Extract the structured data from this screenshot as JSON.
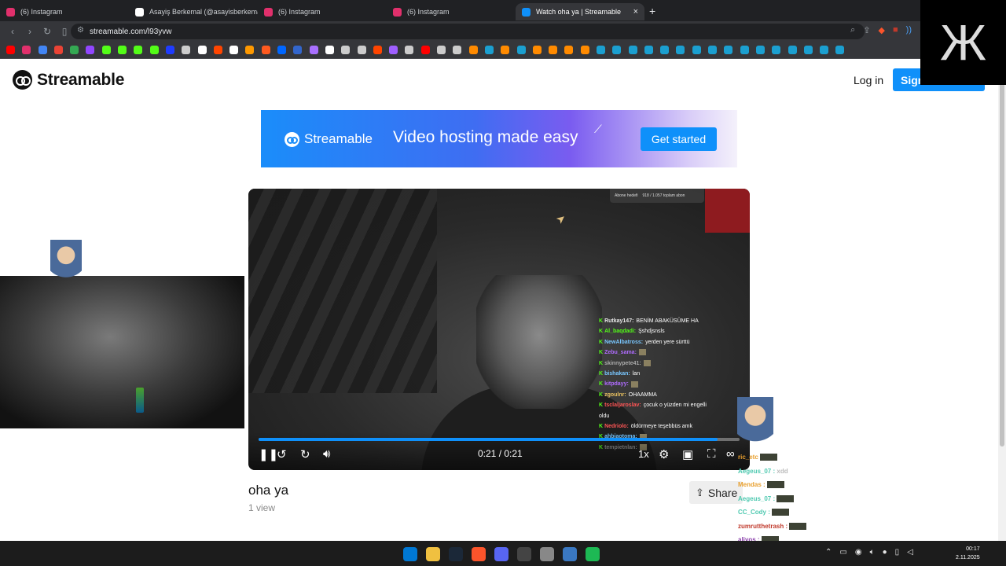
{
  "browser": {
    "tabs": [
      {
        "title": "(6) Instagram",
        "icon": "instagram-icon",
        "color": "#e1306c"
      },
      {
        "title": "Asayiş Berkemal (@asayisberkemal0)",
        "icon": "x-icon",
        "color": "#ffffff"
      },
      {
        "title": "(6) Instagram",
        "icon": "instagram-icon",
        "color": "#e1306c"
      },
      {
        "title": "(6) Instagram",
        "icon": "instagram-icon",
        "color": "#e1306c"
      },
      {
        "title": "Watch oha ya | Streamable",
        "icon": "streamable-icon",
        "color": "#0f90fa",
        "active": true
      }
    ],
    "url": "streamable.com/l93yvw"
  },
  "bookmark_colors": [
    "#ff0000",
    "#e1306c",
    "#4285f4",
    "#ea4335",
    "#34a853",
    "#9146ff",
    "#53fc18",
    "#53fc18",
    "#53fc18",
    "#53fc18",
    "#1f3cff",
    "#cccccc",
    "#ffffff",
    "#ff4500",
    "#ffffff",
    "#ff9900",
    "#ff5a1f",
    "#0066ff",
    "#3366cc",
    "#a970ff",
    "#ffffff",
    "#cccccc",
    "#cccccc",
    "#ff4500",
    "#9f5fff",
    "#cccccc",
    "#ff0000",
    "#cccccc",
    "#cccccc",
    "#ff8a00",
    "#1b9fd0",
    "#ff8a00",
    "#1b9fd0",
    "#ff8a00",
    "#ff8a00",
    "#ff8a00",
    "#ff8a00",
    "#1b9fd0",
    "#1b9fd0",
    "#1b9fd0",
    "#1b9fd0",
    "#1b9fd0",
    "#1b9fd0",
    "#1b9fd0",
    "#1b9fd0",
    "#1b9fd0",
    "#1b9fd0",
    "#1b9fd0",
    "#1b9fd0",
    "#1b9fd0",
    "#1b9fd0",
    "#1b9fd0",
    "#1b9fd0"
  ],
  "site": {
    "brand": "Streamable",
    "login": "Log in",
    "signup": "Sign",
    "accent": "#0f90fa"
  },
  "banner": {
    "brand": "Streamable",
    "tagline": "Video hosting made easy",
    "cta": "Get started"
  },
  "video": {
    "time": "0:21 / 0:21",
    "progress": 0.955,
    "speed": "1x",
    "hud_left": "Abone hedefi",
    "hud_right": "918 / 1.057 toplam abon",
    "chat": [
      {
        "user": "Rutkay147:",
        "msg": "BENİM ABAKÜSÜME HA",
        "color": "#e8e8e8"
      },
      {
        "user": "Al_baqdadi:",
        "msg": "Şshdjsnsls",
        "color": "#53fc18"
      },
      {
        "user": "NewAlbatross:",
        "msg": "yerden yere sürttü",
        "color": "#79c7ff"
      },
      {
        "user": "Zebu_sama:",
        "msg": "",
        "color": "#b06cff",
        "pic": true
      },
      {
        "user": "skinnypete41:",
        "msg": "",
        "color": "#aaaaaa",
        "pic": true
      },
      {
        "user": "bishakan:",
        "msg": "lan",
        "color": "#79c7ff"
      },
      {
        "user": "kitpdayy:",
        "msg": "",
        "color": "#b06cff",
        "pic": true
      },
      {
        "user": "zgoulnr:",
        "msg": "OHAAMMA",
        "color": "#e8c060"
      },
      {
        "user": "tsclaljaroslav:",
        "msg": "çocuk o yüzden mi engelli",
        "color": "#ff5555"
      },
      {
        "user": "",
        "msg": "oldu",
        "color": "#ffffff"
      },
      {
        "user": "Nedriolo:",
        "msg": "öldürmeye teşebbüs amk",
        "color": "#ff5555"
      },
      {
        "user": "ahbiaotoma:",
        "msg": "",
        "color": "#79c7ff",
        "pic": true
      },
      {
        "user": "tempietnlan:",
        "msg": "",
        "color": "#888888",
        "pic": true
      }
    ]
  },
  "meta": {
    "title": "oha ya",
    "views": "1 view",
    "share": "Share"
  },
  "overlay_chat": [
    {
      "user": "ric_etc",
      "color": "#e8a030"
    },
    {
      "user": "Aegeus_07 :",
      "text": "xdd",
      "color": "#4ec9b0"
    },
    {
      "user": "Mendas :",
      "color": "#e8a030"
    },
    {
      "user": "Aegeus_07 :",
      "color": "#4ec9b0"
    },
    {
      "user": "CC_Cody :",
      "color": "#4ec9b0"
    },
    {
      "user": "zumrutthetrash :",
      "color": "#c0392b"
    },
    {
      "user": "aliyos :",
      "color": "#8e44ad"
    }
  ],
  "corner_logo": "Ж",
  "taskbar": {
    "apps": [
      "#0078d4",
      "#f0c040",
      "#1b2838",
      "#fb542b",
      "#5865f2",
      "#444444",
      "#888888",
      "#3a78c2",
      "#1db954"
    ],
    "time": "00:17",
    "date": "2.11.2025"
  }
}
